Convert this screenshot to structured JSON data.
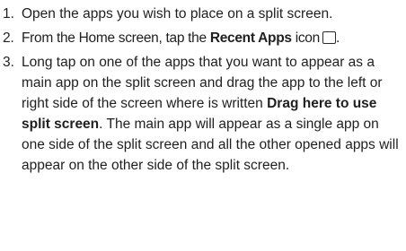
{
  "steps": [
    {
      "number": "1.",
      "text": "Open the apps you wish to place on a split screen."
    },
    {
      "number": "2.",
      "text_before": "From the Home screen, tap the ",
      "bold": "Recent Apps",
      "text_after": " icon",
      "icon": "recent-apps-icon",
      "end": "."
    },
    {
      "number": "3.",
      "text_before": "Long tap on one of the apps that you want to appear as a main app on the split screen and drag the app to the left or right side of the screen where is written ",
      "bold": "Drag here to use split screen",
      "text_after": ". The main app will appear as a single app on one side of the split screen and all the other opened apps will appear on the other side of the split screen."
    }
  ]
}
